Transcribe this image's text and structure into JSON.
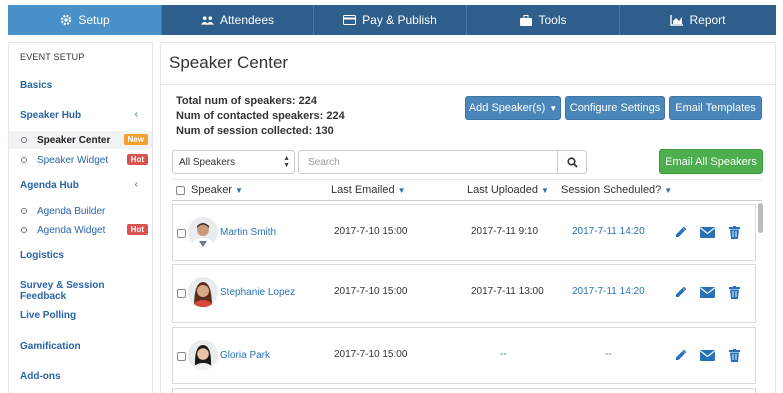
{
  "nav": {
    "tabs": [
      {
        "label": "Setup",
        "icon": "gear-icon",
        "active": true
      },
      {
        "label": "Attendees",
        "icon": "users-icon"
      },
      {
        "label": "Pay & Publish",
        "icon": "card-icon"
      },
      {
        "label": "Tools",
        "icon": "briefcase-icon"
      },
      {
        "label": "Report",
        "icon": "chart-icon"
      }
    ]
  },
  "sidebar": {
    "section_title": "EVENT SETUP",
    "groups": {
      "basics": "Basics",
      "speaker_hub": "Speaker Hub",
      "agenda_hub": "Agenda Hub",
      "logistics": "Logistics",
      "survey": "Survey & Session Feedback",
      "live_polling": "Live Polling",
      "gamification": "Gamification",
      "addons": "Add-ons"
    },
    "caret": "‹",
    "items": {
      "speaker_center": "Speaker Center",
      "speaker_widget": "Speaker Widget",
      "agenda_builder": "Agenda Builder",
      "agenda_widget": "Agenda Widget"
    },
    "badges": {
      "new": "New",
      "hot": "Hot"
    }
  },
  "main": {
    "title": "Speaker Center",
    "stats": {
      "total": "Total num of speakers: 224",
      "contacted": "Num of contacted speakers: 224",
      "sessions": "Num of session collected: 130"
    },
    "buttons": {
      "add_speaker": "Add Speaker(s)",
      "configure": "Configure Settings",
      "email_templates": "Email Templates",
      "email_all": "Email All Speakers"
    },
    "filter_select": "All Speakers",
    "search_placeholder": "Search",
    "columns": {
      "speaker": "Speaker",
      "last_emailed": "Last Emailed",
      "last_uploaded": "Last Uploaded",
      "session_scheduled": "Session Scheduled?"
    },
    "rows": [
      {
        "name": "Martin Smith",
        "last_emailed": "2017-7-10 15:00",
        "last_uploaded": "2017-7-11 9:10",
        "session": "2017-7-11 14:20"
      },
      {
        "name": "Stephanie Lopez",
        "last_emailed": "2017-7-10 15:00",
        "last_uploaded": "2017-7-11 13:00",
        "session": "2017-7-11 14:20"
      },
      {
        "name": "Gloria Park",
        "last_emailed": "2017-7-10 15:00",
        "last_uploaded": "--",
        "session": "--"
      }
    ]
  },
  "colors": {
    "nav_bg": "#2e5e8c",
    "nav_active": "#4a91c9",
    "link": "#2a72b8",
    "badge_new": "#f0a12d",
    "badge_hot": "#d9534f",
    "button_blue": "#4a86b9",
    "button_green": "#4cae4c"
  }
}
